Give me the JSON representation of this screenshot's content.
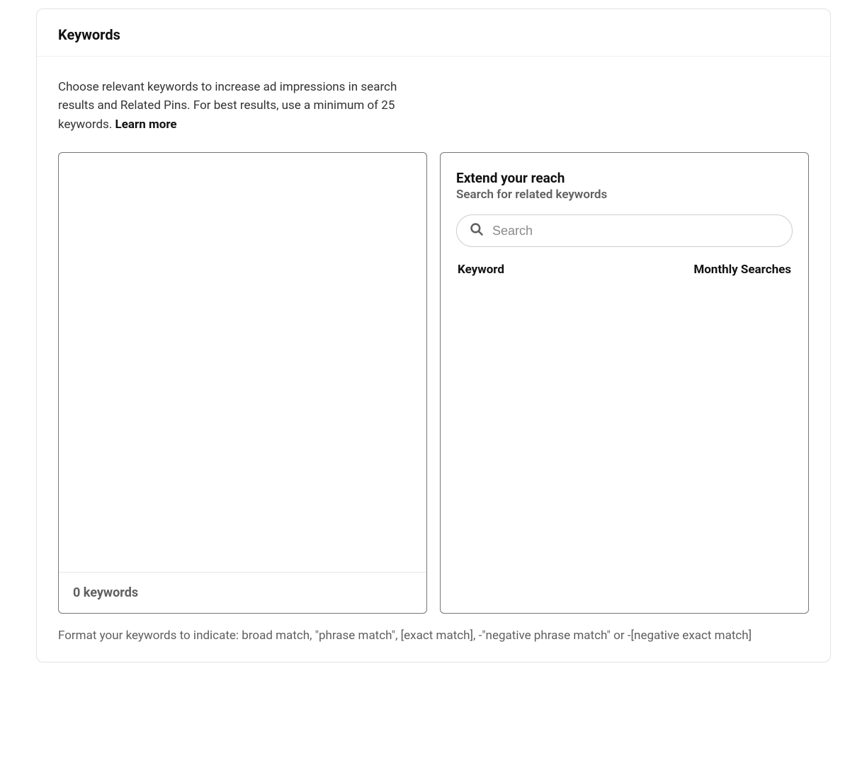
{
  "header": {
    "title": "Keywords"
  },
  "intro": {
    "text": "Choose relevant keywords to increase ad impressions in search results and Related Pins. For best results, use a minimum of 25 keywords. ",
    "learn_more": "Learn more"
  },
  "left_panel": {
    "textarea_value": "",
    "footer": "0 keywords"
  },
  "right_panel": {
    "title": "Extend your reach",
    "subtitle": "Search for related keywords",
    "search_placeholder": "Search",
    "col_keyword": "Keyword",
    "col_searches": "Monthly Searches"
  },
  "format_note": "Format your keywords to indicate: broad match, \"phrase match\", [exact match], -\"negative phrase match\" or -[negative exact match]",
  "icons": {
    "search": "search-icon"
  }
}
